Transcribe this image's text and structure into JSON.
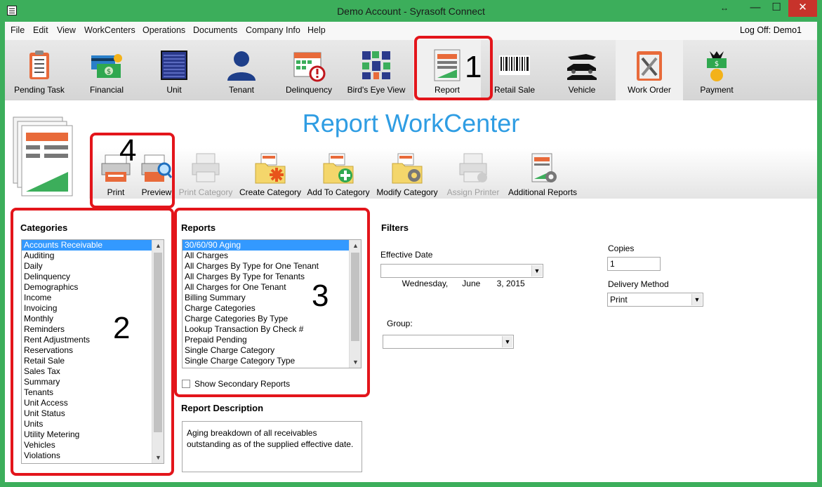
{
  "window": {
    "title": "Demo Account - Syrasoft Connect",
    "controls": {
      "resize": "↔",
      "minimize": "—",
      "maximize": "☐",
      "close": "✕"
    }
  },
  "menu": {
    "items": [
      "File",
      "Edit",
      "View",
      "WorkCenters",
      "Operations",
      "Documents",
      "Company Info",
      "Help"
    ],
    "logoff": "Log Off: Demo1"
  },
  "toolbar": {
    "buttons": [
      {
        "label": "Pending Task",
        "icon": "clipboard-checklist-icon"
      },
      {
        "label": "Financial",
        "icon": "money-card-icon"
      },
      {
        "label": "Unit",
        "icon": "storage-unit-door-icon"
      },
      {
        "label": "Tenant",
        "icon": "person-icon"
      },
      {
        "label": "Delinquency",
        "icon": "calendar-warning-icon"
      },
      {
        "label": "Bird's Eye View",
        "icon": "site-map-icon"
      },
      {
        "label": "Report",
        "icon": "report-icon"
      },
      {
        "label": "Retail Sale",
        "icon": "barcode-icon"
      },
      {
        "label": "Vehicle",
        "icon": "vehicles-icon"
      },
      {
        "label": "Work Order",
        "icon": "tools-clipboard-icon"
      },
      {
        "label": "Payment",
        "icon": "money-bag-icon"
      }
    ]
  },
  "workcenter": {
    "title": "Report WorkCenter"
  },
  "subtoolbar": {
    "buttons": [
      {
        "label": "Print",
        "enabled": true
      },
      {
        "label": "Preview",
        "enabled": true
      },
      {
        "label": "Print Category",
        "enabled": false
      },
      {
        "label": "Create Category",
        "enabled": true
      },
      {
        "label": "Add To Category",
        "enabled": true
      },
      {
        "label": "Modify Category",
        "enabled": true
      },
      {
        "label": "Assign Printer",
        "enabled": false
      },
      {
        "label": "Additional Reports",
        "enabled": true
      }
    ]
  },
  "categories": {
    "title": "Categories",
    "items": [
      "Accounts Receivable",
      "Auditing",
      "Daily",
      "Delinquency",
      "Demographics",
      "Income",
      "Invoicing",
      "Monthly",
      "Reminders",
      "Rent Adjustments",
      "Reservations",
      "Retail Sale",
      "Sales Tax",
      "Summary",
      "Tenants",
      "Unit Access",
      "Unit Status",
      "Units",
      "Utility Metering",
      "Vehicles",
      "Violations"
    ],
    "selected": 0
  },
  "reports": {
    "title": "Reports",
    "items": [
      "30/60/90 Aging",
      "All Charges",
      "All Charges By Type for One Tenant",
      "All Charges By Type for Tenants",
      "All Charges for One Tenant",
      "Billing Summary",
      "Charge Categories",
      "Charge Categories By Type",
      "Lookup Transaction By Check #",
      "Prepaid Pending",
      "Single Charge Category",
      "Single Charge Category Type"
    ],
    "selected": 0,
    "show_secondary_label": "Show Secondary Reports"
  },
  "description": {
    "title": "Report Description",
    "text_line1": "Aging breakdown of all receivables",
    "text_line2": "outstanding as of the supplied effective date."
  },
  "filters": {
    "title": "Filters",
    "effective_date_label": "Effective Date",
    "effective_date_value": "Wednesday,      June       3, 2015",
    "group_label": "Group:",
    "group_value": "",
    "copies_label": "Copies",
    "copies_value": "1",
    "delivery_label": "Delivery Method",
    "delivery_value": "Print"
  },
  "annotations": {
    "one": "1",
    "two": "2",
    "three": "3",
    "four": "4"
  },
  "colors": {
    "window_frame": "#3cae5b",
    "title_accent": "#2f9de3",
    "selection": "#3399ff",
    "annotation": "#e3151b",
    "close_button": "#c7332b"
  }
}
